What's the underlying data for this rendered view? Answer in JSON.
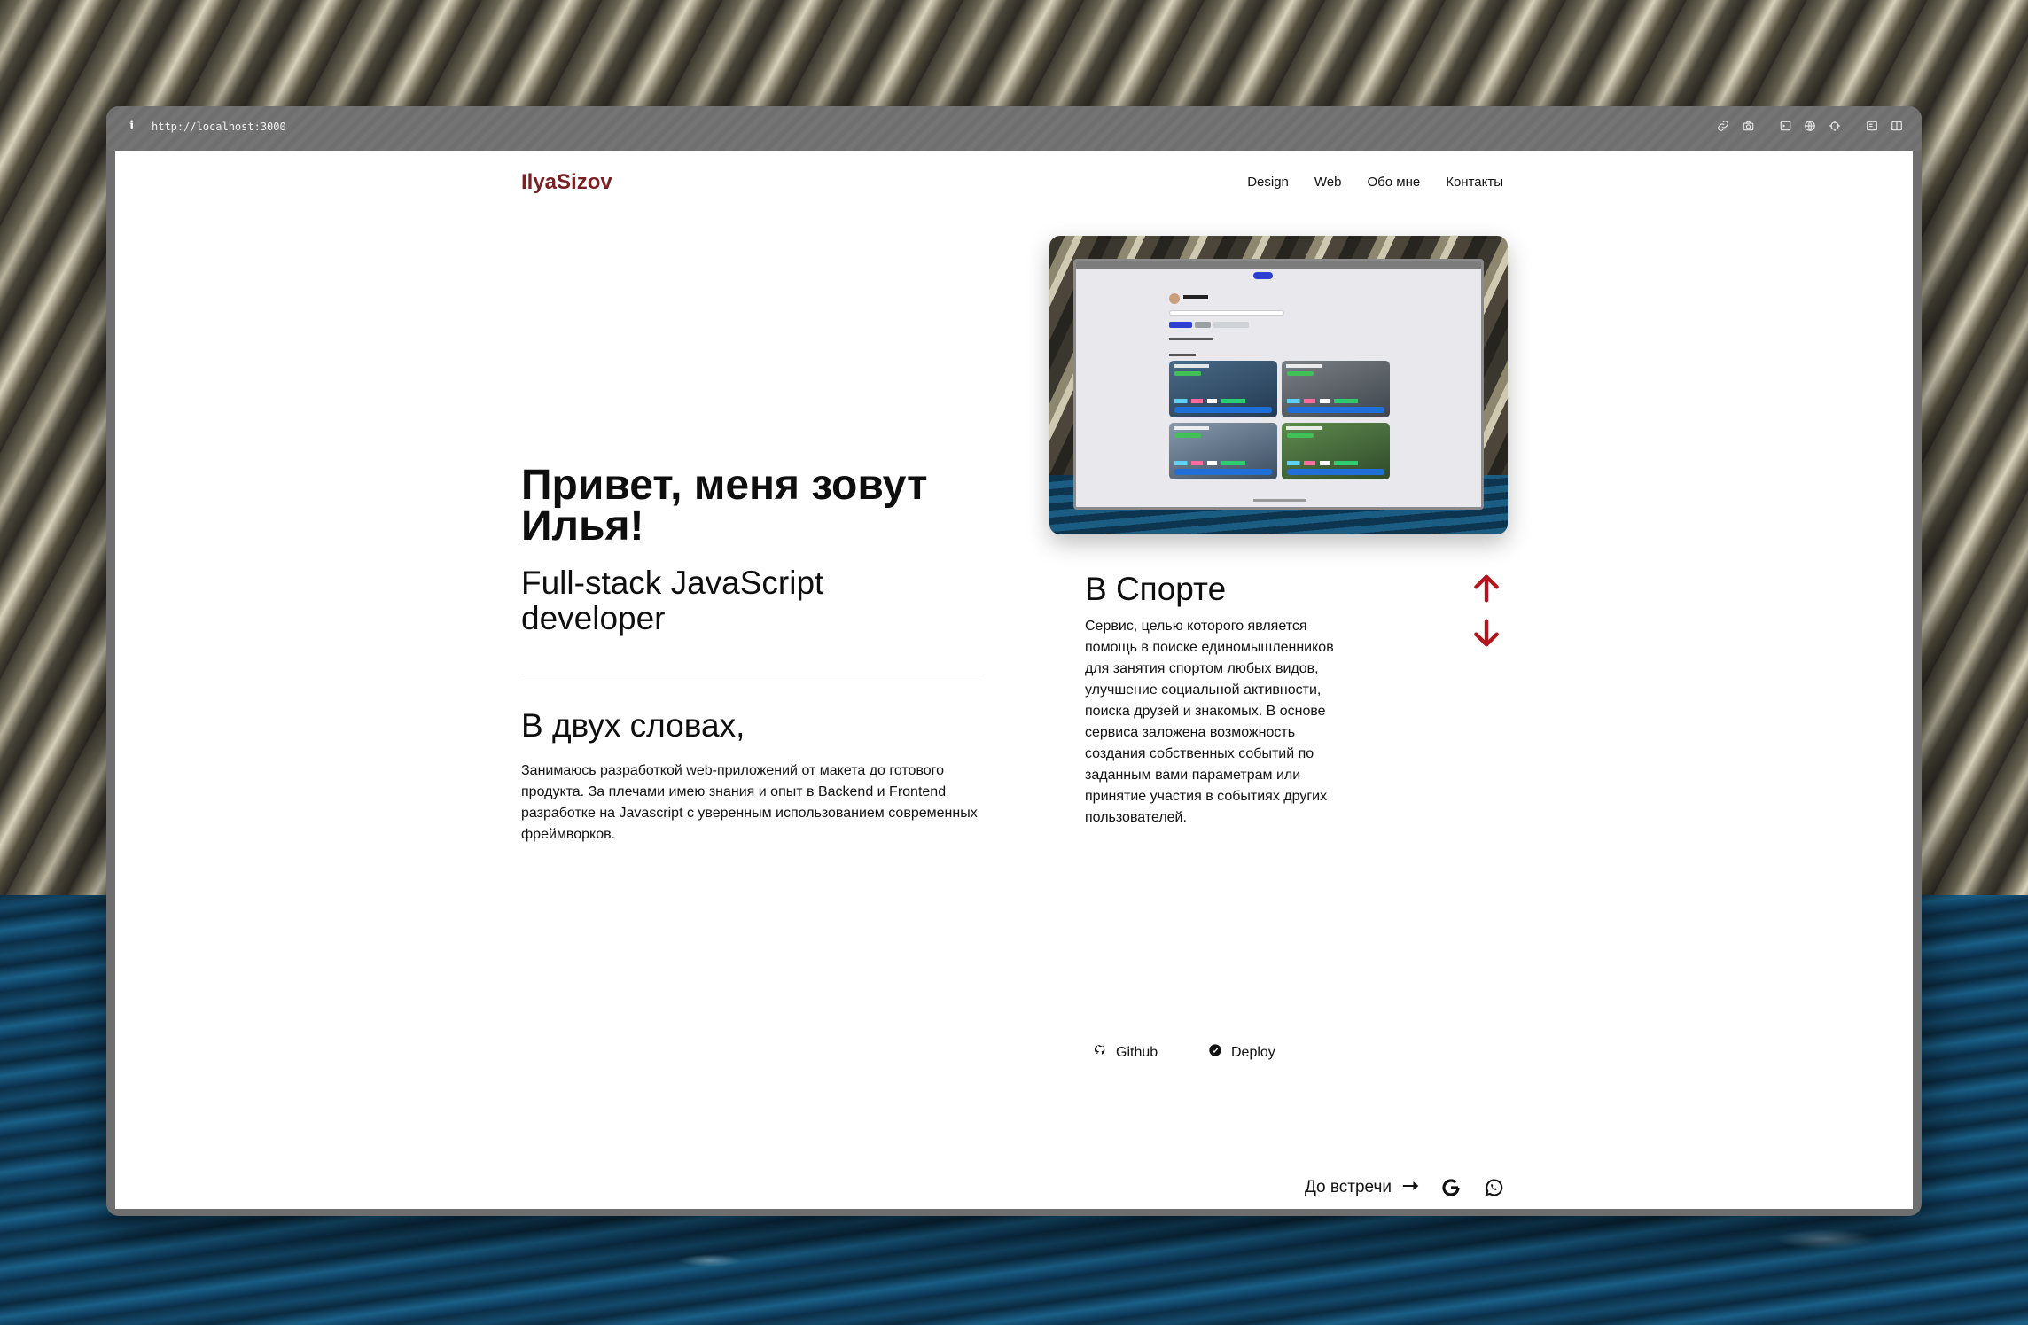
{
  "browser": {
    "info_glyph": "i",
    "url": "http://localhost:3000"
  },
  "site": {
    "logo": "IlyaSizov",
    "nav": [
      "Design",
      "Web",
      "Обо мне",
      "Контакты"
    ]
  },
  "hero": {
    "title": "Привет, меня зовут Илья!",
    "subtitle": "Full-stack JavaScript developer"
  },
  "about": {
    "title": "В двух словах,",
    "text": "Занимаюсь разработкой web-приложений от макета до готового продукта. За плечами имею знания и опыт в Backend и Frontend разработке на Javascript с уверенным использованием современных фреймворков."
  },
  "project": {
    "title": "В Спорте",
    "description": "Сервис, целью которого является помощь в поиске единомышленников для занятия спортом любых видов, улучшение социальной активности, поиска друзей и знакомых. В основе сервиса заложена возможность создания собственных событий по заданным вами параметрам или принятие участия в событиях других пользователей.",
    "github_label": "Github",
    "deploy_label": "Deploy"
  },
  "footer": {
    "bye_text": "До встречи"
  },
  "colors": {
    "brand": "#7a1f22",
    "accent_arrow": "#b3161c"
  },
  "icons": [
    "link-icon",
    "camera-icon",
    "terminal-icon",
    "globe-icon",
    "crosshair-icon",
    "sidebar-left-icon",
    "split-view-icon",
    "arrow-up-icon",
    "arrow-down-icon",
    "github-icon",
    "deploy-icon",
    "arrow-right-icon",
    "google-icon",
    "whatsapp-icon"
  ]
}
